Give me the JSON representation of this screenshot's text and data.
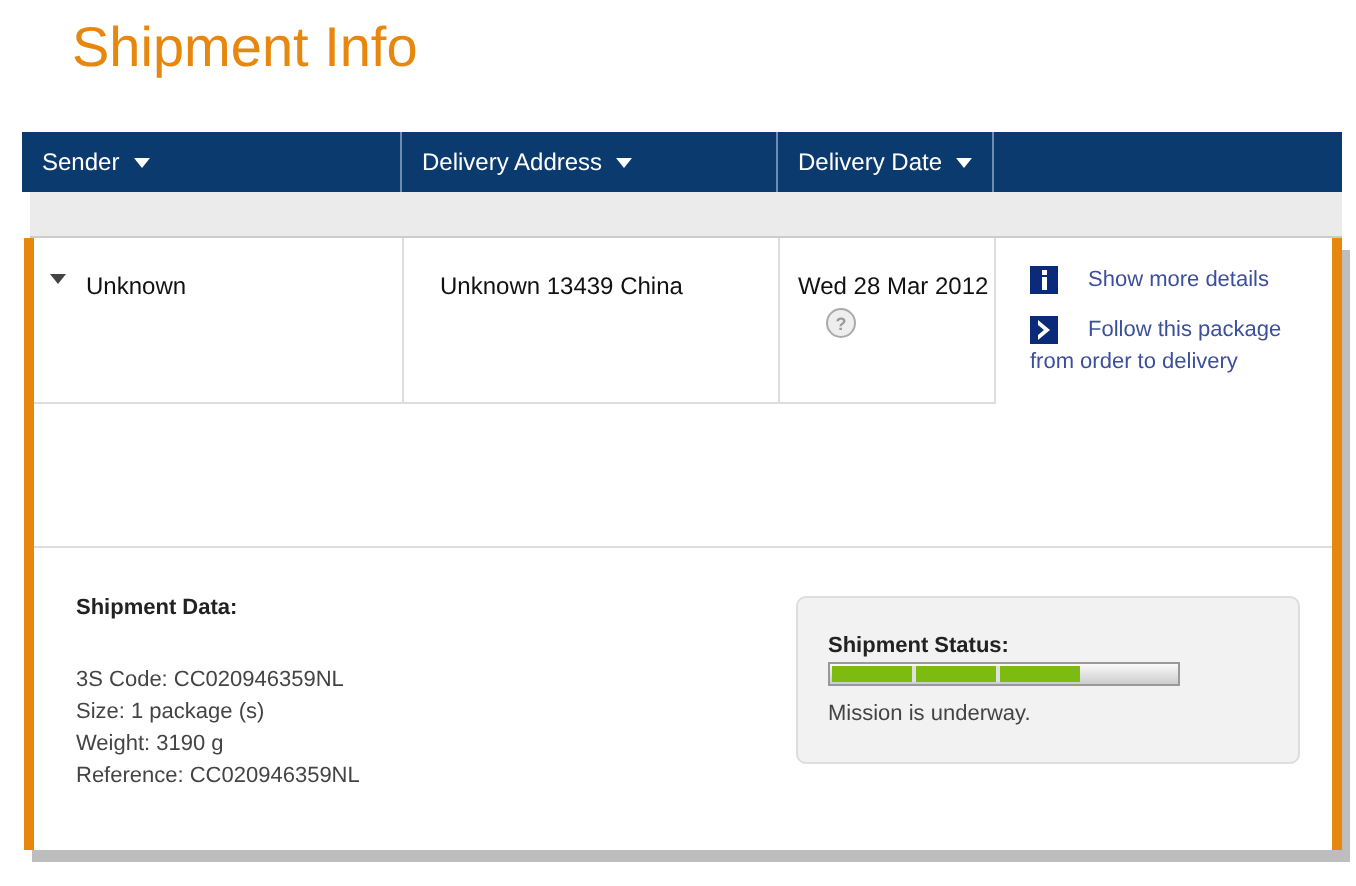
{
  "title": "Shipment Info",
  "columns": [
    {
      "label": "Sender"
    },
    {
      "label": "Delivery Address"
    },
    {
      "label": "Delivery Date"
    }
  ],
  "row": {
    "expanded": true,
    "sender": "Unknown",
    "address": "Unknown 13439 China",
    "date": "Wed 28 Mar 2012",
    "help": "?",
    "actions": [
      {
        "kind": "info",
        "label": "Show more details"
      },
      {
        "kind": "follow",
        "label": "Follow this package",
        "line2": "from order to delivery"
      }
    ]
  },
  "shipment_data": {
    "heading": "Shipment Data:",
    "lines": [
      "3S Code: CC020946359NL",
      "Size: 1 package (s)",
      "Weight: 3190 g",
      "Reference: CC020946359NL"
    ]
  },
  "status": {
    "heading": "Shipment Status:",
    "level": 0.72,
    "message": "Mission is underway."
  }
}
